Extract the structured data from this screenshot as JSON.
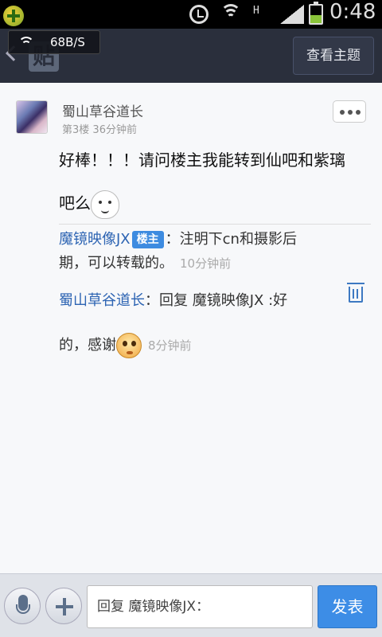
{
  "status_bar": {
    "network_type": "H",
    "time": "0:48"
  },
  "title_bar": {
    "speed_text": "68B/S",
    "tie_icon_text": "贴",
    "view_topic_label": "查看主题"
  },
  "post": {
    "username": "蜀山草谷道长",
    "floor": "第3楼",
    "time": "36分钟前",
    "content_line1": "好棒！！！请问楼主我能转到仙吧和紫璃",
    "content_line2": "吧么"
  },
  "replies": [
    {
      "user": "魔镜映像JX",
      "badge": "楼主",
      "text_a": "：注明下cn和摄影后",
      "text_b": "期，可以转载的。",
      "time": "10分钟前"
    },
    {
      "user": "蜀山草谷道长",
      "text_a": "：回复 魔镜映像JX :好",
      "text_b": "的，感谢",
      "time": "8分钟前"
    }
  ],
  "bottom_bar": {
    "input_value": "回复 魔镜映像JX：",
    "send_label": "发表"
  },
  "icons": {
    "app": "plus-circle-icon",
    "alarm": "alarm-icon",
    "wifi": "wifi-icon",
    "signal": "signal-icon",
    "battery": "battery-charging-icon",
    "back": "back-icon",
    "more": "more-icon",
    "trash": "trash-icon",
    "mic": "microphone-icon",
    "plus": "plus-icon"
  },
  "colors": {
    "link_blue": "#2d64b3",
    "badge_blue": "#3d8be0",
    "send_button": "#3d8de6",
    "title_bar": "#2a2f3c"
  }
}
